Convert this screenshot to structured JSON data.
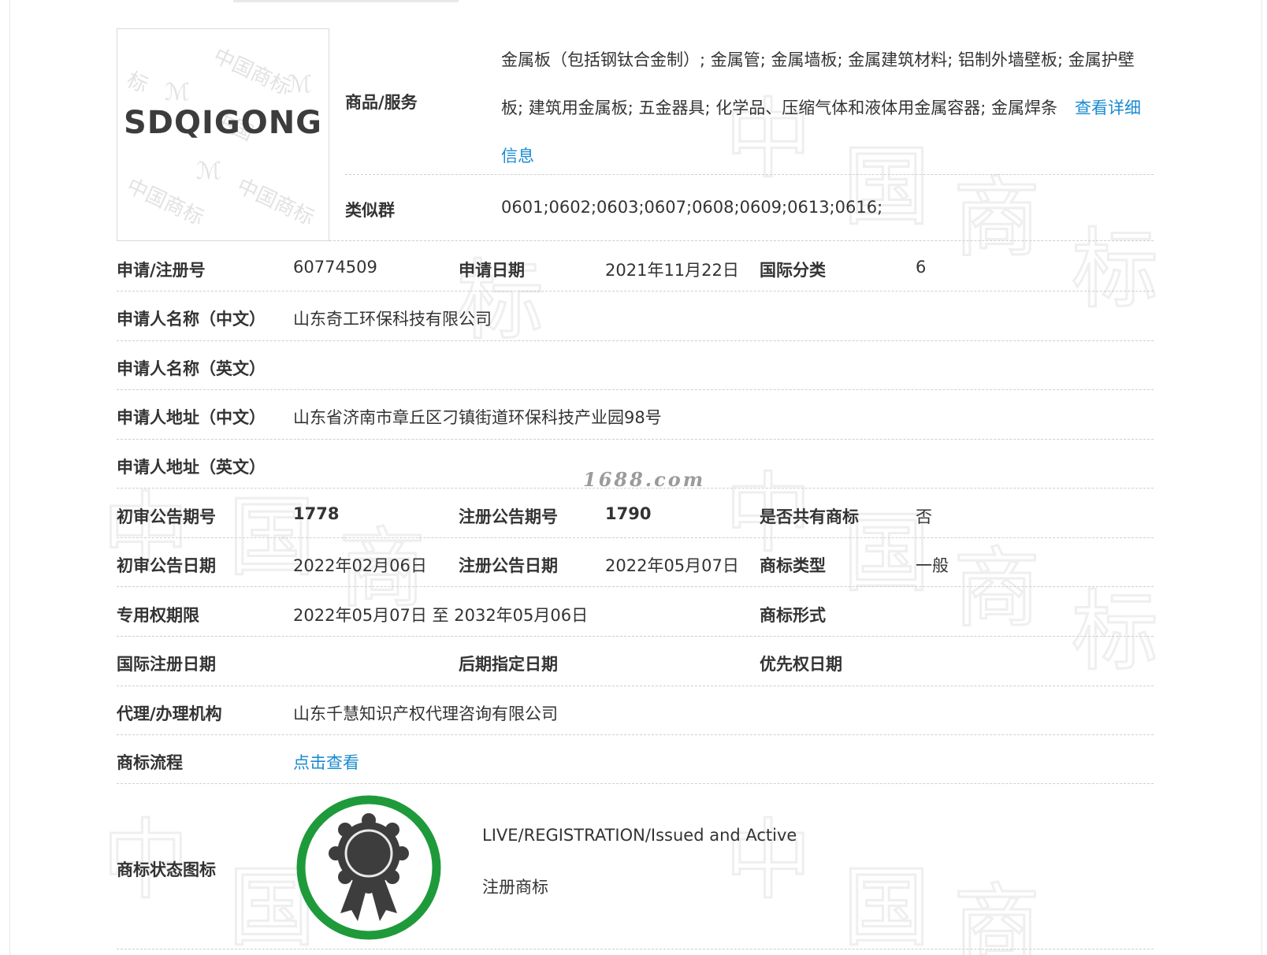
{
  "logo": {
    "text": "SDQIGONG"
  },
  "goods": {
    "label": "商品/服务",
    "text": "金属板（包括钢钛合金制）; 金属管; 金属墙板; 金属建筑材料; 铝制外墙壁板; 金属护壁板; 建筑用金属板; 五金器具; 化学品、压缩气体和液体用金属容器; 金属焊条",
    "link": "查看详细信息"
  },
  "similar": {
    "label": "类似群",
    "value": "0601;0602;0603;0607;0608;0609;0613;0616;"
  },
  "rows": {
    "reg_no": {
      "label": "申请/注册号",
      "value": "60774509"
    },
    "app_date": {
      "label": "申请日期",
      "value": "2021年11月22日"
    },
    "intl_class": {
      "label": "国际分类",
      "value": "6"
    },
    "applicant_cn": {
      "label": "申请人名称（中文）",
      "value": "山东奇工环保科技有限公司"
    },
    "applicant_en": {
      "label": "申请人名称（英文）",
      "value": ""
    },
    "address_cn": {
      "label": "申请人地址（中文）",
      "value": "山东省济南市章丘区刁镇街道环保科技产业园98号"
    },
    "address_en": {
      "label": "申请人地址（英文）",
      "value": ""
    },
    "prelim_no": {
      "label": "初审公告期号",
      "value": "1778"
    },
    "reg_pub_no": {
      "label": "注册公告期号",
      "value": "1790"
    },
    "shared": {
      "label": "是否共有商标",
      "value": "否"
    },
    "prelim_date": {
      "label": "初审公告日期",
      "value": "2022年02月06日"
    },
    "reg_pub_date": {
      "label": "注册公告日期",
      "value": "2022年05月07日"
    },
    "tm_type": {
      "label": "商标类型",
      "value": "一般"
    },
    "exclusive": {
      "label": "专用权期限",
      "value": "2022年05月07日 至 2032年05月06日"
    },
    "tm_form": {
      "label": "商标形式",
      "value": ""
    },
    "intl_reg_date": {
      "label": "国际注册日期",
      "value": ""
    },
    "later_date": {
      "label": "后期指定日期",
      "value": ""
    },
    "priority_date": {
      "label": "优先权日期",
      "value": ""
    },
    "agent": {
      "label": "代理/办理机构",
      "value": "山东千慧知识产权代理咨询有限公司"
    },
    "process": {
      "label": "商标流程",
      "link": "点击查看"
    },
    "status": {
      "label": "商标状态图标",
      "en": "LIVE/REGISTRATION/Issued and Active",
      "cn": "注册商标"
    }
  },
  "watermark": {
    "site": "1688.com",
    "chars": [
      "中",
      "国",
      "商",
      "标"
    ]
  },
  "colors": {
    "link": "#1a8bd0",
    "status_ring": "#1e9a3b",
    "badge": "#3d3d3d"
  }
}
